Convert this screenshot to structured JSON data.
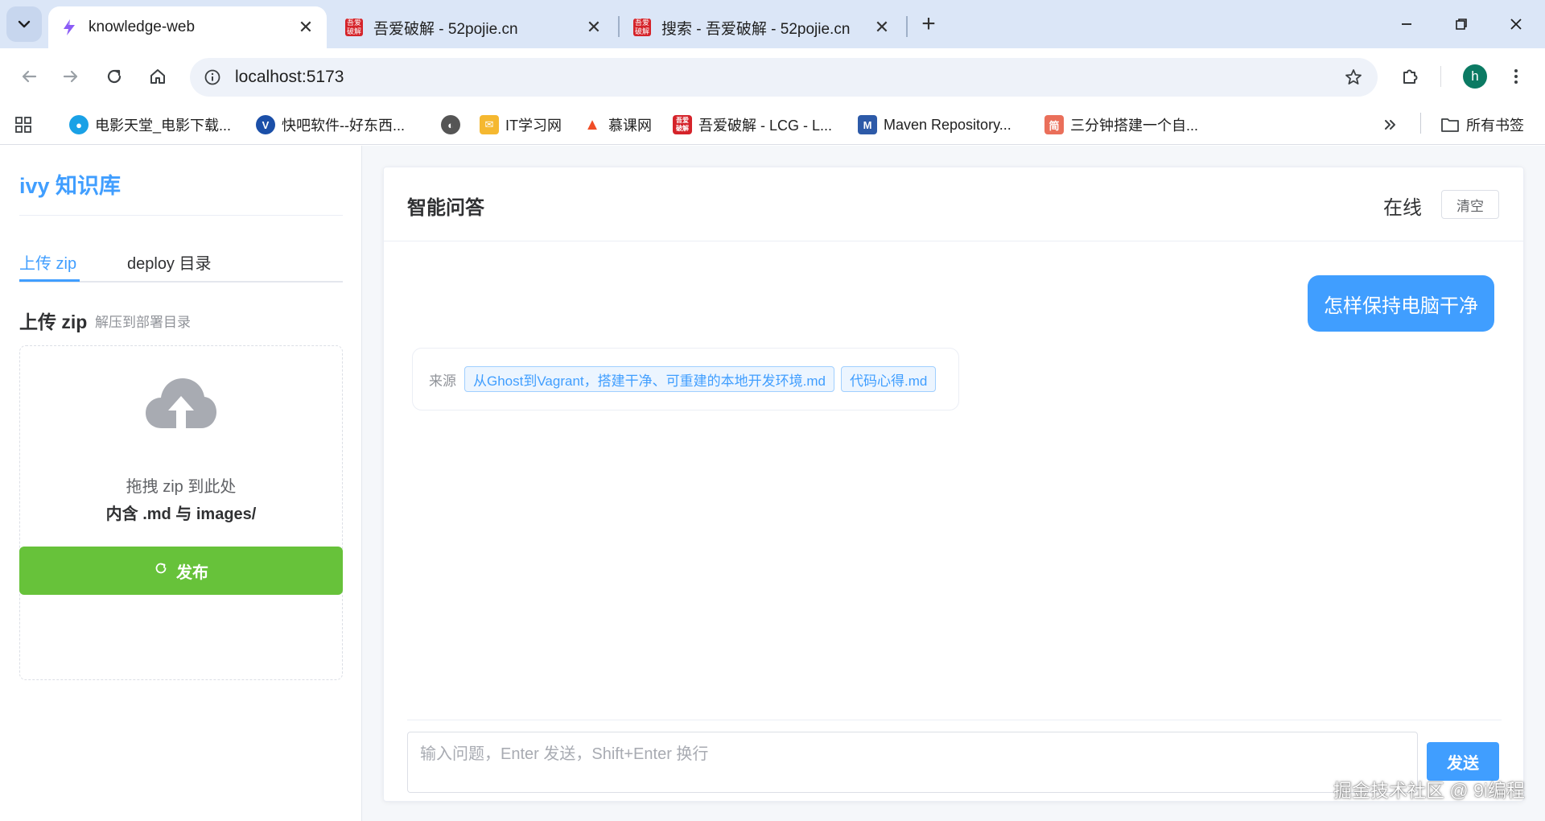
{
  "browser": {
    "tabs": [
      {
        "title": "knowledge-web",
        "active": true
      },
      {
        "title": "吾爱破解 - 52pojie.cn",
        "active": false
      },
      {
        "title": "搜索 - 吾爱破解 - 52pojie.cn",
        "active": false
      }
    ],
    "new_tab_label": "+",
    "url": "localhost:5173",
    "profile_initial": "h",
    "bookmarks": [
      {
        "label": "电影天堂_电影下载...",
        "icon": "film-icon",
        "color": "#1aa1e6"
      },
      {
        "label": "快吧软件--好东西...",
        "icon": "v-icon",
        "color": "#1b4fa8"
      },
      {
        "label": "",
        "icon": "globe-icon",
        "color": "#444444"
      },
      {
        "label": "IT学习网",
        "icon": "folder-mail-icon",
        "color": "#f5b830"
      },
      {
        "label": "慕课网",
        "icon": "flame-icon",
        "color": "#f04d26"
      },
      {
        "label": "吾爱破解 - LCG - L...",
        "icon": "52pojie-icon",
        "color": "#d5232a"
      },
      {
        "label": "Maven Repository...",
        "icon": "maven-icon",
        "color": "#2d5aa8"
      },
      {
        "label": "三分钟搭建一个自...",
        "icon": "jianshu-icon",
        "color": "#ea6f5a"
      }
    ],
    "all_bookmarks_label": "所有书签"
  },
  "sidebar": {
    "brand": "ivy 知识库",
    "tabs": [
      {
        "label": "上传 zip",
        "active": true
      },
      {
        "label": "deploy 目录",
        "active": false
      }
    ],
    "section_title": "上传 zip",
    "section_subtitle": "解压到部署目录",
    "dropzone_line1": "拖拽 zip 到此处",
    "dropzone_line2": "内含 .md 与 images/",
    "publish_label": "发布"
  },
  "chat": {
    "title": "智能问答",
    "status": "在线",
    "clear_label": "清空",
    "user_message": "怎样保持电脑干净",
    "sources_label": "来源",
    "sources": [
      "从Ghost到Vagrant，搭建干净、可重建的本地开发环境.md",
      "代码心得.md"
    ],
    "input_placeholder": "输入问题，Enter 发送，Shift+Enter 换行",
    "send_label": "发送"
  },
  "watermark": "掘金技术社区 @ 9i编程",
  "colors": {
    "primary": "#409eff",
    "success": "#67c23a",
    "tabstrip": "#dbe6f7"
  }
}
